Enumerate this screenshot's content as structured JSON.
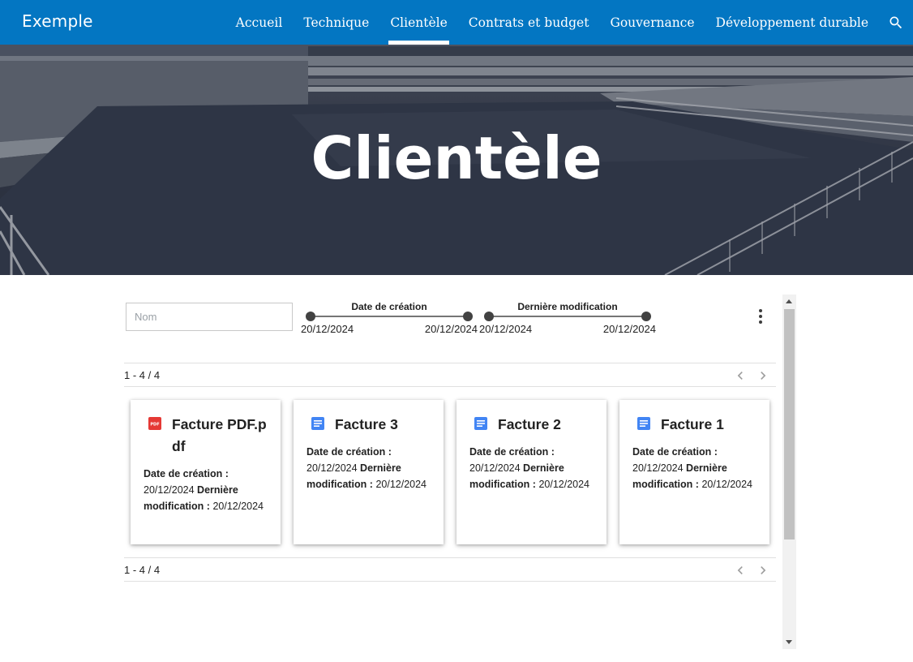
{
  "site": {
    "title": "Exemple"
  },
  "nav": {
    "items": [
      {
        "label": "Accueil"
      },
      {
        "label": "Technique"
      },
      {
        "label": "Clientèle"
      },
      {
        "label": "Contrats et budget"
      },
      {
        "label": "Gouvernance"
      },
      {
        "label": "Développement durable"
      }
    ],
    "active": "Clientèle",
    "search_icon": "search-icon"
  },
  "hero": {
    "title": "Clientèle"
  },
  "filters": {
    "name_placeholder": "Nom",
    "created": {
      "label": "Date de création",
      "from": "20/12/2024",
      "to": "20/12/2024"
    },
    "modified": {
      "label": "Dernière modification",
      "from": "20/12/2024",
      "to": "20/12/2024"
    },
    "menu_icon": "more-vert-icon"
  },
  "pagination": {
    "top": "1 - 4 / 4",
    "bottom": "1 - 4 / 4"
  },
  "files": [
    {
      "title": "Facture PDF.pdf",
      "icon": "pdf-icon",
      "created_label": "Date de création :",
      "created": "20/12/2024",
      "modified_label": "Dernière modification :",
      "modified": "20/12/2024"
    },
    {
      "title": "Facture 3",
      "icon": "doc-icon",
      "created_label": "Date de création :",
      "created": "20/12/2024",
      "modified_label": "Dernière modification :",
      "modified": "20/12/2024"
    },
    {
      "title": "Facture 2",
      "icon": "doc-icon",
      "created_label": "Date de création :",
      "created": "20/12/2024",
      "modified_label": "Dernière modification :",
      "modified": "20/12/2024"
    },
    {
      "title": "Facture 1",
      "icon": "doc-icon",
      "created_label": "Date de création :",
      "created": "20/12/2024",
      "modified_label": "Dernière modification :",
      "modified": "20/12/2024"
    }
  ],
  "colors": {
    "nav_bg": "#0376c2",
    "pdf_red": "#e53935",
    "doc_blue": "#4285f4"
  }
}
